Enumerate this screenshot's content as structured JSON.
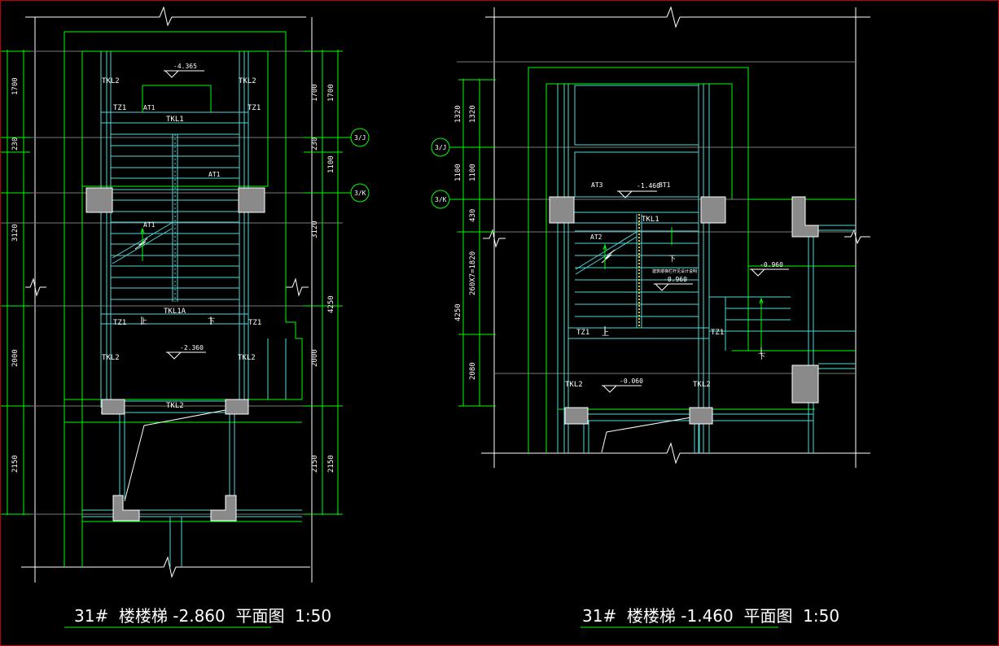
{
  "colors": {
    "background": "#000000",
    "white": "#ffffff",
    "green": "#00ff00",
    "cyan": "#4fd8d8",
    "column_fill": "#8a8a8a",
    "frame": "#c00000"
  },
  "left_plan": {
    "title": "31#  楼楼梯 -2.860  平面图  1:50",
    "dims_left": [
      "1700",
      "230",
      "3120",
      "2000",
      "2150"
    ],
    "dims_right_inner": [
      "1700",
      "230",
      "3120",
      "2000",
      "2150"
    ],
    "dims_right_outer": [
      "1700",
      "1100",
      "4250",
      "2150"
    ],
    "labels": {
      "tkl2_tl": "TKL2",
      "tkl2_tr": "TKL2",
      "tz1_tl": "TZ1",
      "tz1_tr": "TZ1",
      "at1_top": "AT1",
      "tkl1": "TKL1",
      "at1_right": "AT1",
      "at1_mid": "AT1",
      "tkl1a": "TKL1A",
      "up": "上",
      "down": "下",
      "tz1_bl": "TZ1",
      "tz1_br": "TZ1",
      "tkl2_ml": "TKL2",
      "tkl2_mr": "TKL2",
      "tkl2_bottom": "TKL2"
    },
    "elevations": [
      "-4.365",
      "-2.360"
    ],
    "axis_tags": [
      "3/J",
      "3/K"
    ]
  },
  "right_plan": {
    "title": "31#  楼楼梯 -1.460  平面图  1:50",
    "dims_left": [
      "1320",
      "1100",
      "430",
      "260X7=1820",
      "2080"
    ],
    "dims_left_outer": [
      "1320",
      "1100",
      "4250"
    ],
    "labels": {
      "at3": "AT3",
      "bt1": "BT1",
      "tkl1": "TKL1",
      "at2": "AT2",
      "note": "建筑楼梯栏杆见设计说明",
      "tz1_l": "TZ1",
      "tz1_r": "TZ1",
      "up": "上",
      "down_mid": "下",
      "down_right": "下",
      "tkl2_l": "TKL2",
      "tkl2_r": "TKL2"
    },
    "elevations": [
      "-1.460",
      "-0.960",
      "-0.960",
      "-0.060"
    ],
    "axis_tags": [
      "3/J",
      "3/K"
    ]
  }
}
